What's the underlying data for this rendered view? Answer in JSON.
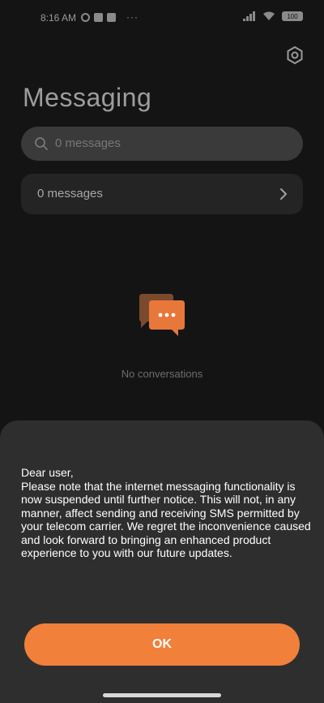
{
  "status_bar": {
    "time": "8:16 AM",
    "dots": "···",
    "battery": "100"
  },
  "header": {
    "title": "Messaging",
    "settings_icon": "gear-icon"
  },
  "search": {
    "placeholder": "0 messages",
    "icon": "search-icon"
  },
  "messages_row": {
    "label": "0 messages",
    "icon": "chevron-right-icon"
  },
  "empty_state": {
    "icon": "chat-bubbles-icon",
    "label": "No conversations"
  },
  "notice": {
    "text": "Dear user,\nPlease note that the internet messaging functionality is now suspended until further notice. This will not, in any manner, affect sending and receiving SMS permitted by your telecom carrier. We regret the inconvenience caused and look forward to bringing an enhanced product experience to you with our future updates.",
    "ok_label": "OK"
  },
  "colors": {
    "accent": "#f0803a",
    "background": "#141414",
    "sheet": "#2e2e2e"
  }
}
